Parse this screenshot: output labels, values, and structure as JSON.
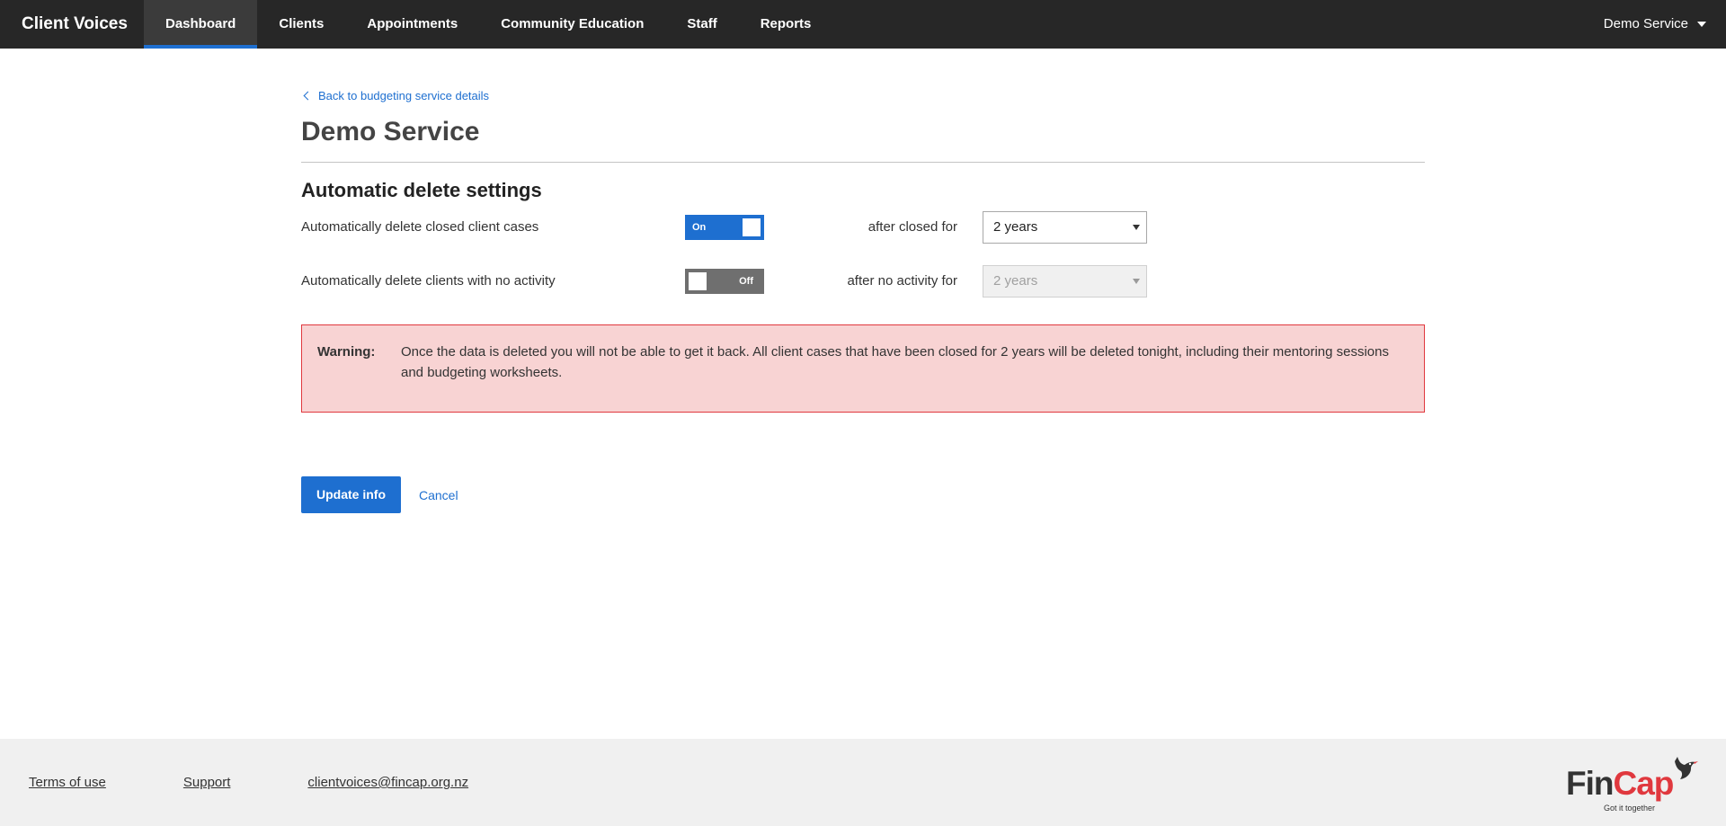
{
  "app": {
    "brand": "Client Voices",
    "nav": [
      {
        "label": "Dashboard",
        "active": true
      },
      {
        "label": "Clients",
        "active": false
      },
      {
        "label": "Appointments",
        "active": false
      },
      {
        "label": "Community Education",
        "active": false
      },
      {
        "label": "Staff",
        "active": false
      },
      {
        "label": "Reports",
        "active": false
      }
    ],
    "account_menu": "Demo Service"
  },
  "page": {
    "back_link": "Back to budgeting service details",
    "title": "Demo Service",
    "section_title": "Automatic delete settings"
  },
  "settings": {
    "closed_cases": {
      "label": "Automatically delete closed client cases",
      "toggle_state": "On",
      "after_label": "after closed for",
      "period": "2 years",
      "enabled": true
    },
    "no_activity": {
      "label": "Automatically delete clients with no activity",
      "toggle_state": "Off",
      "after_label": "after no activity for",
      "period": "2 years",
      "enabled": false
    }
  },
  "warning": {
    "label": "Warning:",
    "text": "Once the data is deleted you will not be able to get it back. All client cases that have been closed for 2 years will be deleted tonight, including their mentoring sessions and budgeting worksheets."
  },
  "actions": {
    "submit": "Update info",
    "cancel": "Cancel"
  },
  "footer": {
    "links": [
      "Terms of use",
      "Support",
      "clientvoices@fincap.org.nz"
    ],
    "logo_prefix": "Fin",
    "logo_suffix": "Cap",
    "logo_tagline": "Got it together"
  },
  "colors": {
    "nav_bg": "#272727",
    "accent": "#1e6fd0",
    "warning_bg": "#f8d3d3",
    "warning_border": "#e0383e",
    "footer_bg": "#f0f0f0"
  }
}
